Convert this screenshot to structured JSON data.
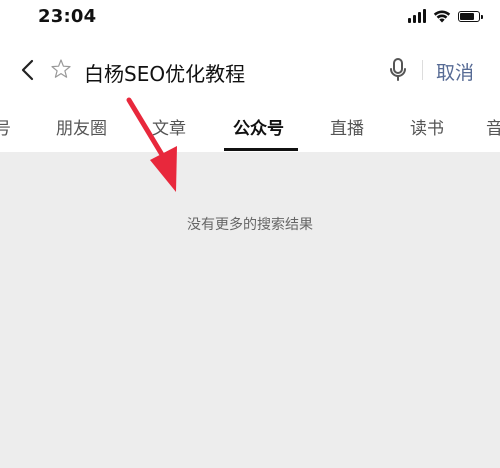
{
  "status_bar": {
    "time": "23:04",
    "icons": [
      "signal-icon",
      "wifi-icon",
      "battery-icon"
    ],
    "battery_level": 0.85
  },
  "search": {
    "query": "白杨SEO优化教程",
    "cancel_label": "取消",
    "icons": [
      "back-icon",
      "star-icon",
      "mic-icon"
    ]
  },
  "tabs": [
    {
      "label": "号"
    },
    {
      "label": "朋友圈"
    },
    {
      "label": "文章"
    },
    {
      "label": "公众号",
      "active": true
    },
    {
      "label": "直播"
    },
    {
      "label": "读书"
    },
    {
      "label": "音"
    }
  ],
  "results": {
    "empty_message": "没有更多的搜索结果"
  },
  "colors": {
    "accent_link": "#576b95",
    "annotation_arrow": "#e8283c",
    "results_background": "#ededed"
  }
}
